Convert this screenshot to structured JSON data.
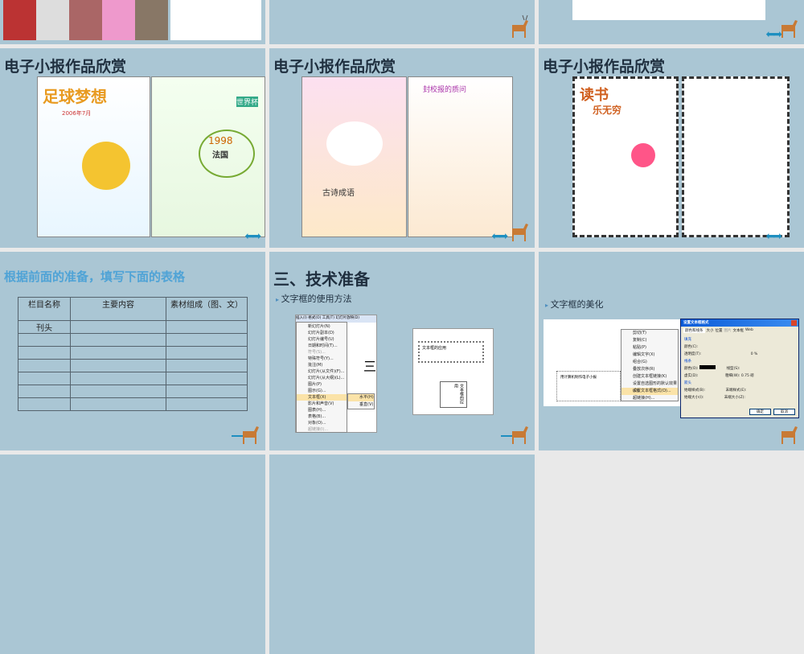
{
  "slides": [
    {
      "index": 1,
      "title": ""
    },
    {
      "index": 2,
      "title": ""
    },
    {
      "index": 3,
      "title": ""
    },
    {
      "index": 4,
      "title": "电子小报作品欣赏",
      "poster_texts": [
        "足球梦想",
        "2006年7月",
        "1998",
        "法国",
        "世界杯"
      ]
    },
    {
      "index": 5,
      "title": "电子小报作品欣赏",
      "poster_texts": [
        "封校报的质问",
        "古诗成语"
      ]
    },
    {
      "index": 6,
      "title": "电子小报作品欣赏",
      "poster_texts": [
        "读书",
        "乐无穷"
      ]
    },
    {
      "index": 7,
      "title": "根据前面的准备，填写下面的表格",
      "table": {
        "headers": [
          "栏目名称",
          "主要内容",
          "素材组成（图、文）"
        ],
        "rows": [
          [
            "刊头",
            "",
            ""
          ],
          [
            "",
            "",
            ""
          ],
          [
            "",
            "",
            ""
          ],
          [
            "",
            "",
            ""
          ],
          [
            "",
            "",
            ""
          ],
          [
            "",
            "",
            ""
          ],
          [
            "",
            "",
            ""
          ],
          [
            "",
            "",
            ""
          ]
        ]
      }
    },
    {
      "index": 8,
      "title": "三、技术准备",
      "bullet": "文字框的使用方法",
      "menu": {
        "bar": [
          "插入(I)",
          "格式(O)",
          "工具(T)",
          "幻灯片放映(D)",
          "窗口"
        ],
        "items": [
          "新幻灯片(N)",
          "幻灯片副本(D)",
          "幻灯片编号(U)",
          "日期和时间(T)...",
          "符号(S)...",
          "特殊符号(Y)...",
          "批注(M)",
          "幻灯片(从文件)(F)...",
          "幻灯片(从大纲)(L)...",
          "图片(P)",
          "图示(G)...",
          "文本框(X)",
          "影片和声音(V)",
          "图表(H)...",
          "表格(B)...",
          "对象(O)...",
          "超链接(I)..."
        ],
        "submenu": [
          "水平(H)",
          "垂直(V)"
        ]
      },
      "sample_h": "文本框的应用",
      "sample_v": "文本框的应用"
    },
    {
      "index": 9,
      "bullet": "文字框的美化",
      "sample": "用计算机制作电子小报",
      "context_menu": [
        "剪切(T)",
        "复制(C)",
        "粘贴(P)",
        "编辑文字(X)",
        "组合(G)",
        "叠放次序(R)",
        "创建文本框链接(K)",
        "设置自选图形的默认效果(D)",
        "设置文本框格式(O)...",
        "超链接(H)..."
      ],
      "dialog": {
        "title": "设置文本框格式",
        "tabs": [
          "颜色和线条",
          "大小",
          "位置",
          "图片",
          "文本框",
          "Web"
        ],
        "fill": "填充",
        "color": "颜色(C):",
        "transparency": "透明度(T):",
        "transparency_value": "0 %",
        "line": "线条",
        "line_color": "颜色(O):",
        "line_type": "线型(S):",
        "dash": "虚实(D):",
        "weight": "粗细(W):",
        "weight_value": "0.75 磅",
        "arrows": "箭头",
        "begin_style": "始端样式(B):",
        "end_style": "末端样式(E):",
        "begin_size": "始端大小(I):",
        "end_size": "末端大小(Z):",
        "ok": "确定",
        "cancel": "取消"
      }
    }
  ]
}
